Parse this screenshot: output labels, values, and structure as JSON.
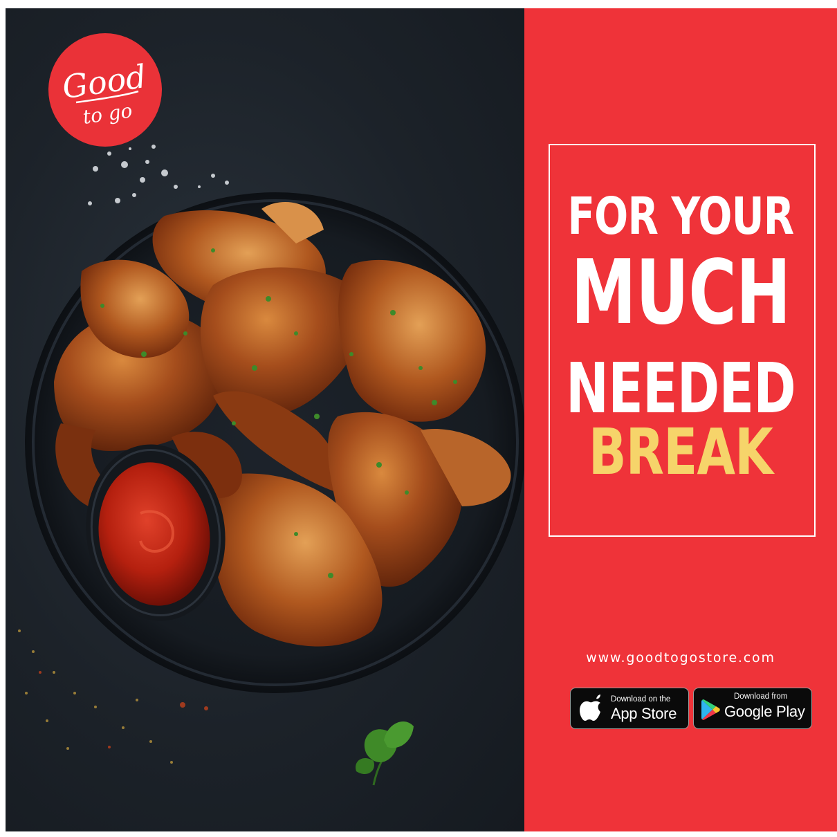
{
  "brand": {
    "logo_line1": "Good",
    "logo_line2": "to go"
  },
  "headline": {
    "line1": "FOR YOUR",
    "line2": "MUCH",
    "line3": "NEEDED",
    "line4": "BREAK"
  },
  "website": "www.goodtogostore.com",
  "app_store": {
    "small": "Download on the",
    "big": "App Store"
  },
  "google_play": {
    "small": "Download from",
    "big": "Google Play"
  },
  "colors": {
    "accent_red": "#ef3339",
    "highlight_yellow": "#f6d46a",
    "background_dark": "#1c2229"
  },
  "icons": [
    "apple-icon",
    "google-play-icon",
    "parsley-leaf-icon"
  ]
}
